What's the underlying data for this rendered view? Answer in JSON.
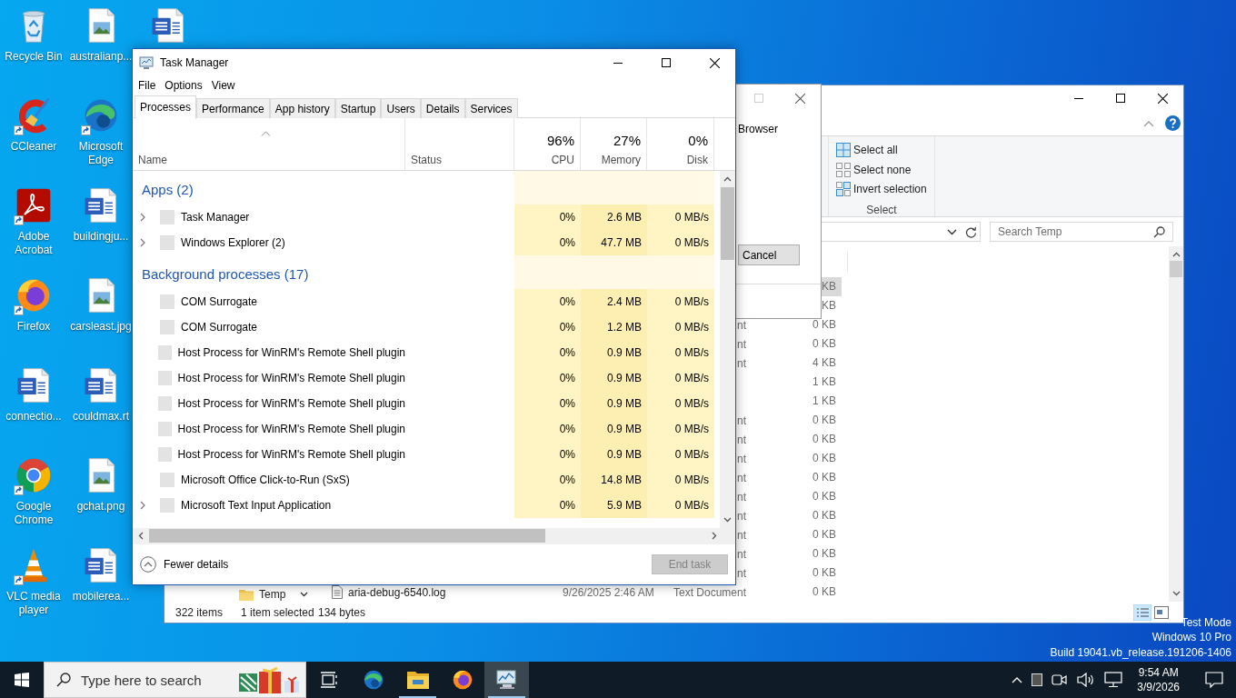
{
  "desktop": {
    "icons": [
      {
        "label": "Recycle Bin",
        "kind": "recycle",
        "shortcut": false
      },
      {
        "label": "CCleaner",
        "kind": "ccleaner",
        "shortcut": true
      },
      {
        "label": "Adobe Acrobat",
        "kind": "acrobat",
        "shortcut": true
      },
      {
        "label": "Firefox",
        "kind": "firefox",
        "shortcut": true
      },
      {
        "label": "connectio...",
        "kind": "word",
        "shortcut": false
      },
      {
        "label": "Google Chrome",
        "kind": "chrome",
        "shortcut": true
      },
      {
        "label": "VLC media player",
        "kind": "vlc",
        "shortcut": true
      },
      {
        "label": "australianp...",
        "kind": "image",
        "shortcut": false
      },
      {
        "label": "Microsoft Edge",
        "kind": "edge",
        "shortcut": true
      },
      {
        "label": "buildingju...",
        "kind": "word",
        "shortcut": false
      },
      {
        "label": "carsleast.jpg",
        "kind": "image",
        "shortcut": false
      },
      {
        "label": "couldmax.rt",
        "kind": "word",
        "shortcut": false
      },
      {
        "label": "gchat.png",
        "kind": "image",
        "shortcut": false
      },
      {
        "label": "mobilerea...",
        "kind": "word",
        "shortcut": false
      },
      {
        "kind": "word",
        "shortcut": false
      }
    ]
  },
  "explorer": {
    "ribbon": {
      "group": "Select",
      "commands": [
        {
          "label": "Select all",
          "kind": "all"
        },
        {
          "label": "Select none",
          "kind": "none"
        },
        {
          "label": "Invert selection",
          "kind": "invert"
        }
      ]
    },
    "search": {
      "placeholder": "Search Temp"
    },
    "nav": {
      "label": "Temp"
    },
    "files": [
      {
        "size": "KB",
        "selected": true
      },
      {
        "size": "KB",
        "selected": false
      },
      {
        "type": "nt",
        "size": "0 KB",
        "selected": false
      },
      {
        "type": "nt",
        "size": "0 KB",
        "selected": false
      },
      {
        "type": "nt",
        "size": "4 KB",
        "selected": false
      },
      {
        "size": "1 KB",
        "selected": false
      },
      {
        "size": "1 KB",
        "selected": false
      },
      {
        "type": "nt",
        "size": "0 KB",
        "selected": false
      },
      {
        "type": "nt",
        "size": "0 KB",
        "selected": false
      },
      {
        "type": "nt",
        "size": "0 KB",
        "selected": false
      },
      {
        "type": "nt",
        "size": "0 KB",
        "selected": false
      },
      {
        "type": "nt",
        "size": "0 KB",
        "selected": false
      },
      {
        "type": "nt",
        "size": "0 KB",
        "selected": false
      },
      {
        "type": "nt",
        "size": "0 KB",
        "selected": false
      },
      {
        "type": "nt",
        "size": "0 KB",
        "selected": false
      },
      {
        "type": "nt",
        "size": "0 KB",
        "selected": false
      },
      {
        "name": "aria-debug-6540.log",
        "date": "9/26/2025 2:46 AM",
        "type": "Text Document",
        "size": "0 KB",
        "selected": false
      }
    ],
    "status": {
      "count": "322 items",
      "selection": "1 item selected",
      "size": "134 bytes"
    }
  },
  "dialog": {
    "text": "Browser",
    "button": "Cancel"
  },
  "task_manager": {
    "title": "Task Manager",
    "menu": [
      "File",
      "Options",
      "View"
    ],
    "tabs": [
      {
        "label": "Processes",
        "selected": true
      },
      {
        "label": "Performance",
        "selected": false
      },
      {
        "label": "App history",
        "selected": false
      },
      {
        "label": "Startup",
        "selected": false
      },
      {
        "label": "Users",
        "selected": false
      },
      {
        "label": "Details",
        "selected": false
      },
      {
        "label": "Services",
        "selected": false
      }
    ],
    "columns": [
      {
        "label": "Name"
      },
      {
        "label": "Status"
      },
      {
        "percent": "96%",
        "label": "CPU"
      },
      {
        "percent": "27%",
        "label": "Memory"
      },
      {
        "percent": "0%",
        "label": "Disk"
      }
    ],
    "groups": [
      {
        "title": "Apps (2)",
        "rows": [
          {
            "name": "Task Manager",
            "expandable": true,
            "cpu": "0%",
            "memory": "2.6 MB",
            "disk": "0 MB/s"
          },
          {
            "name": "Windows Explorer (2)",
            "expandable": true,
            "cpu": "0%",
            "memory": "47.7 MB",
            "disk": "0 MB/s"
          }
        ]
      },
      {
        "title": "Background processes (17)",
        "rows": [
          {
            "name": "COM Surrogate",
            "expandable": false,
            "cpu": "0%",
            "memory": "2.4 MB",
            "disk": "0 MB/s"
          },
          {
            "name": "COM Surrogate",
            "expandable": false,
            "cpu": "0%",
            "memory": "1.2 MB",
            "disk": "0 MB/s"
          },
          {
            "name": "Host Process for WinRM's Remote Shell plugin",
            "expandable": false,
            "cpu": "0%",
            "memory": "0.9 MB",
            "disk": "0 MB/s"
          },
          {
            "name": "Host Process for WinRM's Remote Shell plugin",
            "expandable": false,
            "cpu": "0%",
            "memory": "0.9 MB",
            "disk": "0 MB/s"
          },
          {
            "name": "Host Process for WinRM's Remote Shell plugin",
            "expandable": false,
            "cpu": "0%",
            "memory": "0.9 MB",
            "disk": "0 MB/s"
          },
          {
            "name": "Host Process for WinRM's Remote Shell plugin",
            "expandable": false,
            "cpu": "0%",
            "memory": "0.9 MB",
            "disk": "0 MB/s"
          },
          {
            "name": "Host Process for WinRM's Remote Shell plugin",
            "expandable": false,
            "cpu": "0%",
            "memory": "0.9 MB",
            "disk": "0 MB/s"
          },
          {
            "name": "Microsoft Office Click-to-Run (SxS)",
            "expandable": false,
            "cpu": "0%",
            "memory": "14.8 MB",
            "disk": "0 MB/s"
          },
          {
            "name": "Microsoft Text Input Application",
            "expandable": true,
            "cpu": "0%",
            "memory": "5.9 MB",
            "disk": "0 MB/s"
          }
        ]
      }
    ],
    "footer": {
      "toggle": "Fewer details",
      "end_task": {
        "label": "End task",
        "disabled": true
      }
    }
  },
  "taskbar": {
    "search": {
      "placeholder": "Type here to search"
    },
    "apps": [
      {
        "kind": "taskview",
        "running": false,
        "active": false
      },
      {
        "kind": "edge",
        "running": false,
        "active": false
      },
      {
        "kind": "explorer",
        "running": true,
        "active": false
      },
      {
        "kind": "firefox",
        "running": false,
        "active": false
      },
      {
        "kind": "taskmanager",
        "running": true,
        "active": true
      }
    ],
    "clock": {
      "time": "9:54 AM",
      "date": "3/9/2026"
    }
  },
  "os_info": [
    "Test Mode",
    "Windows 10 Pro",
    "Build 19041.vb_release.191206-1406"
  ]
}
